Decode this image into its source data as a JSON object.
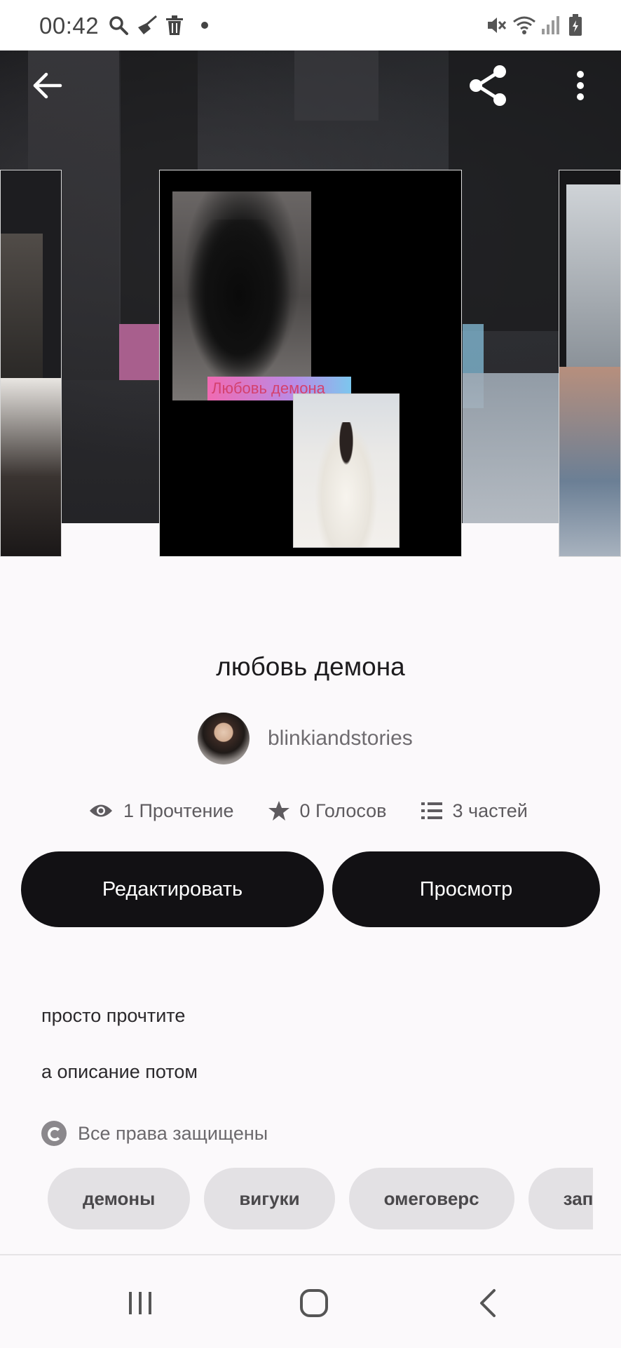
{
  "status_bar": {
    "time": "00:42",
    "left_icons": [
      "search-icon",
      "broom-icon",
      "trash-icon",
      "dot-icon"
    ],
    "right_icons": [
      "mute-icon",
      "wifi-icon",
      "signal-icon",
      "battery-icon"
    ]
  },
  "header": {
    "back_icon": "arrow-left-icon",
    "share_icon": "share-icon",
    "more_icon": "more-vertical-icon"
  },
  "cover": {
    "label": "Любовь демона"
  },
  "story": {
    "title": "любовь демона",
    "author": "blinkiandstories",
    "stats": {
      "reads": "1 Прочтение",
      "votes": "0 Голосов",
      "parts": "3 частей"
    }
  },
  "actions": {
    "edit_label": "Редактировать",
    "view_label": "Просмотр"
  },
  "description": {
    "line1": "просто прочтите",
    "line2": "а описание потом"
  },
  "rights": "Все права защищены",
  "tags": [
    "демоны",
    "вигуки",
    "омеговерс",
    "запрещено"
  ],
  "nav": {
    "recent_icon": "recent-apps-icon",
    "home_icon": "home-icon",
    "back_icon": "back-chevron-icon"
  },
  "colors": {
    "button_bg": "#121114",
    "tag_bg": "#e3e1e4",
    "page_bg": "#fbf9fb"
  }
}
